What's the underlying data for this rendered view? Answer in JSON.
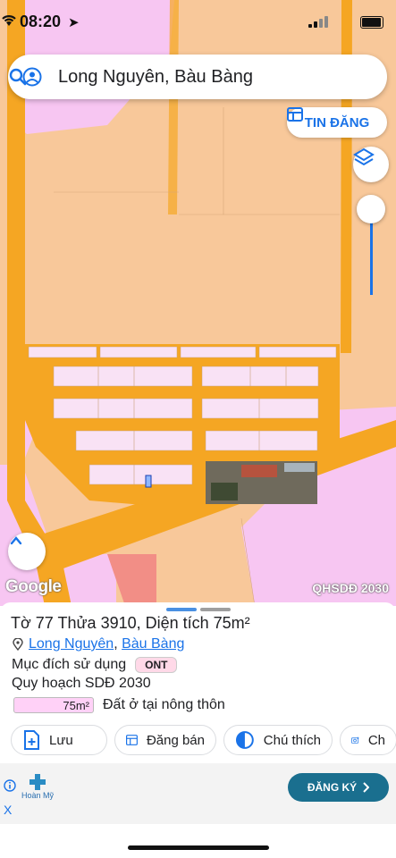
{
  "status_bar": {
    "time": "08:20"
  },
  "search": {
    "query": "Long Nguyên, Bàu Bàng"
  },
  "map": {
    "tin_dang_label": "TIN ĐĂNG",
    "brand": "Google",
    "layer_badge": "QHSDĐ 2030"
  },
  "parcel": {
    "title": "Tờ 77 Thửa 3910, Diện tích 75m²",
    "commune": "Long Nguyên",
    "district": "Bàu Bàng",
    "separator": ",",
    "purpose_label": "Mục đích sử dụng",
    "purpose_code": "ONT",
    "plan_label": "Quy hoạch SDĐ 2030",
    "plan_area": "75m²",
    "plan_description": "Đất ở tại nông thôn"
  },
  "actions": [
    {
      "label": "Lưu",
      "icon": "save-icon"
    },
    {
      "label": "Đăng bán",
      "icon": "sell-icon"
    },
    {
      "label": "Chú thích",
      "icon": "legend-icon"
    },
    {
      "label": "Ch",
      "icon": "camera-icon"
    }
  ],
  "ad": {
    "brand": "Hoàn Mỹ",
    "cta_label": "ĐĂNG KÝ",
    "close": "X"
  },
  "colors": {
    "accent": "#1a73e8",
    "road": "#f5a623",
    "residential": "#f8c89a",
    "public": "#f7c6f2",
    "ad_button": "#1a6f8f"
  }
}
